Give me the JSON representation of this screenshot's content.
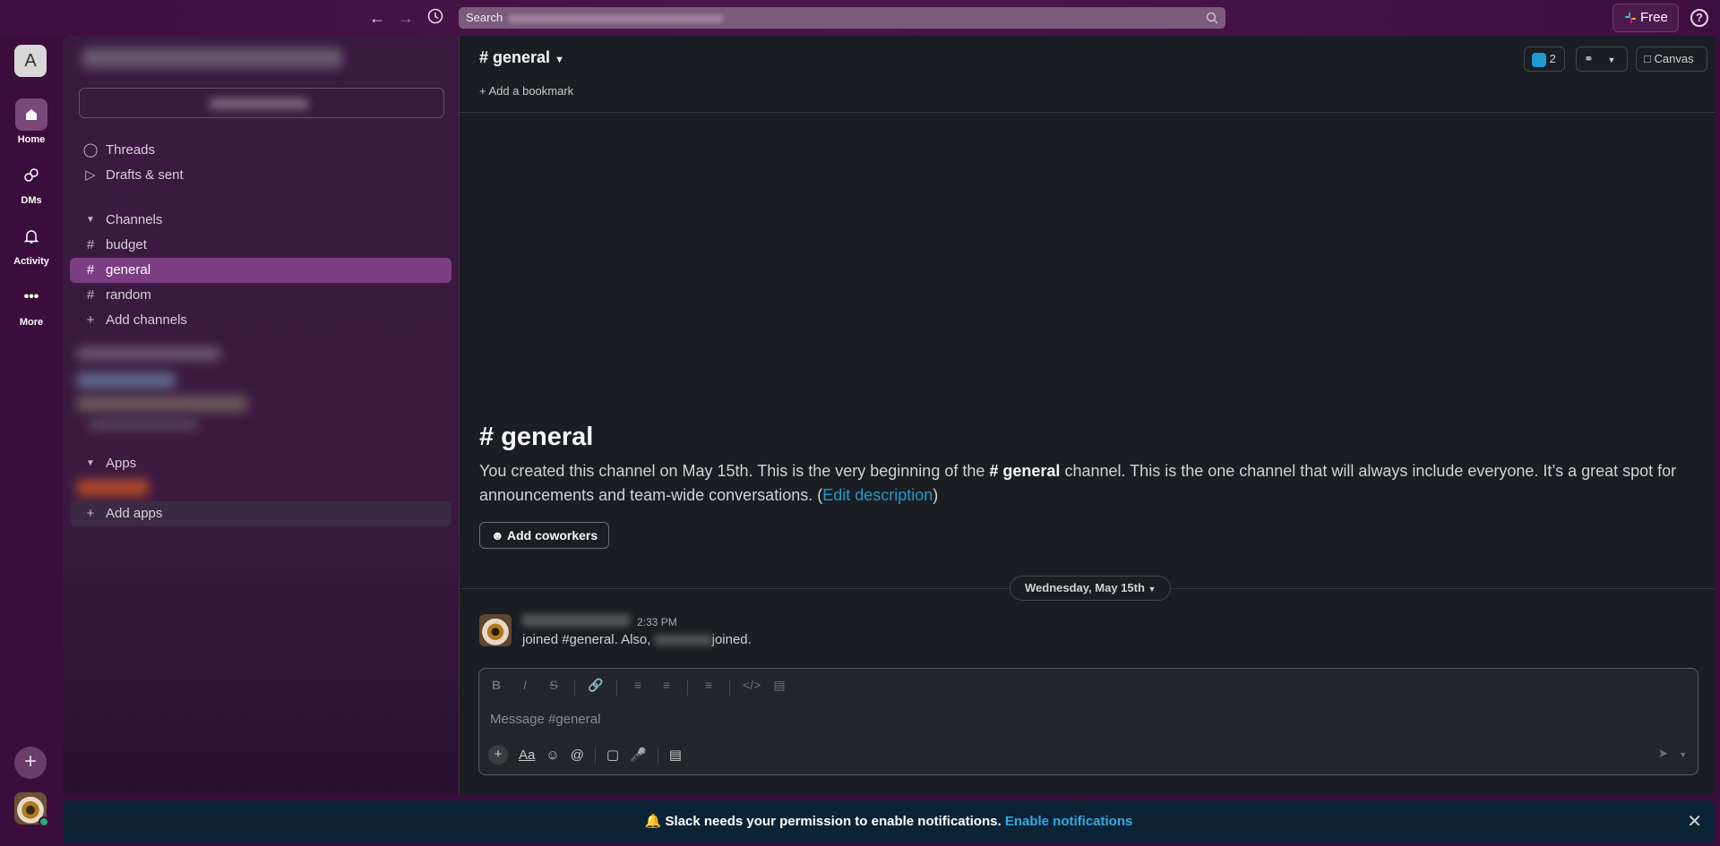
{
  "topbar": {
    "search_placeholder": "Search",
    "free_label": "Free",
    "help": "?"
  },
  "rail": {
    "workspace_initial": "A",
    "items": [
      {
        "label": "Home"
      },
      {
        "label": "DMs"
      },
      {
        "label": "Activity"
      },
      {
        "label": "More"
      }
    ]
  },
  "sidebar": {
    "threads": "Threads",
    "drafts": "Drafts & sent",
    "channels_header": "Channels",
    "channels": [
      {
        "name": "budget"
      },
      {
        "name": "general"
      },
      {
        "name": "random"
      }
    ],
    "add_channels": "Add channels",
    "apps_header": "Apps",
    "add_apps": "Add apps"
  },
  "channel": {
    "title": "general",
    "member_count": "2",
    "canvas_label": "Canvas",
    "add_bookmark": "Add a bookmark",
    "intro_title": "general",
    "intro_text_1": "You created this channel on May 15th. This is the very beginning of the",
    "intro_channel": "general",
    "intro_text_2": "channel. This is the one channel that will always include everyone. It’s a great spot for announcements and team-wide conversations. (",
    "edit_description": "Edit description",
    "intro_text_3": ")",
    "add_coworkers": "Add coworkers",
    "date_divider": "Wednesday, May 15th"
  },
  "message": {
    "time": "2:33 PM",
    "text_1": "joined #general. Also,",
    "text_2": "joined."
  },
  "composer": {
    "placeholder": "Message #general"
  },
  "banner": {
    "text": "Slack needs your permission to enable notifications.",
    "link": "Enable notifications"
  }
}
